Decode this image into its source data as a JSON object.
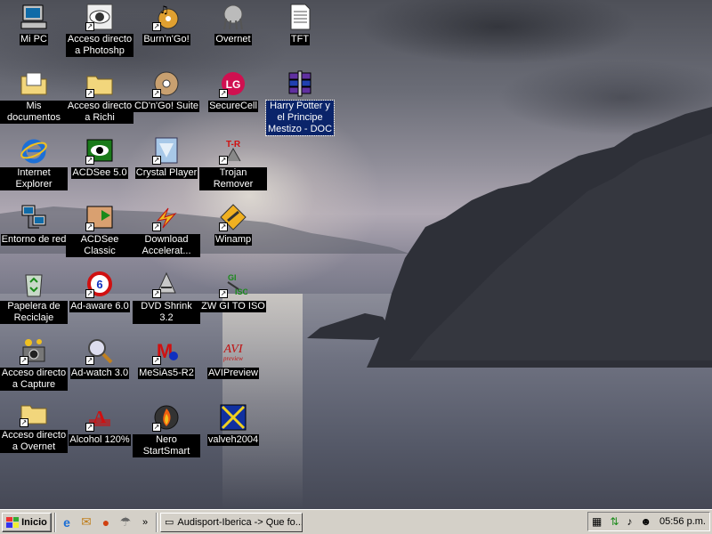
{
  "desktop": {
    "icons": [
      {
        "label": "Mi PC",
        "icon": "my-computer-icon",
        "shortcut": false
      },
      {
        "label": "Acceso directo a Photoshp",
        "icon": "photoshop-eye-icon",
        "shortcut": true
      },
      {
        "label": "Burn'n'Go!",
        "icon": "burn-n-go-icon",
        "shortcut": true
      },
      {
        "label": "Overnet",
        "icon": "overnet-icon",
        "shortcut": false
      },
      {
        "label": "TFT",
        "icon": "text-document-icon",
        "shortcut": false
      },
      {
        "label": "Mis documentos",
        "icon": "my-documents-folder-icon",
        "shortcut": false
      },
      {
        "label": "Acceso directo a Richi",
        "icon": "folder-icon",
        "shortcut": true
      },
      {
        "label": "CD'n'Go! Suite",
        "icon": "cd-disc-icon",
        "shortcut": true
      },
      {
        "label": "SecureCell",
        "icon": "securecell-icon",
        "shortcut": true
      },
      {
        "label": "Harry Potter y el Principe Mestizo - DOC",
        "icon": "winrar-archive-icon",
        "shortcut": false
      },
      {
        "label": "Internet Explorer",
        "icon": "internet-explorer-icon",
        "shortcut": false
      },
      {
        "label": "ACDSee 5.0",
        "icon": "acdsee-eye-icon",
        "shortcut": true
      },
      {
        "label": "Crystal Player",
        "icon": "crystal-player-icon",
        "shortcut": true
      },
      {
        "label": "Trojan Remover",
        "icon": "trojan-remover-icon",
        "shortcut": true
      },
      {
        "label": "Entorno de red",
        "icon": "network-computers-icon",
        "shortcut": false
      },
      {
        "label": "ACDSee Classic",
        "icon": "acdsee-classic-icon",
        "shortcut": true
      },
      {
        "label": "Download Accelerat...",
        "icon": "download-accelerator-icon",
        "shortcut": true
      },
      {
        "label": "Winamp",
        "icon": "winamp-icon",
        "shortcut": true
      },
      {
        "label": "Papelera de Reciclaje",
        "icon": "recycle-bin-icon",
        "shortcut": false
      },
      {
        "label": "Ad-aware 6.0",
        "icon": "ad-aware-icon",
        "shortcut": true
      },
      {
        "label": "DVD Shrink 3.2",
        "icon": "dvd-shrink-icon",
        "shortcut": true
      },
      {
        "label": "ZW GI TO ISO",
        "icon": "gi-to-iso-icon",
        "shortcut": true
      },
      {
        "label": "Acceso directo a Capture",
        "icon": "camera-icon",
        "shortcut": true
      },
      {
        "label": "Ad-watch 3.0",
        "icon": "ad-watch-magnifier-icon",
        "shortcut": true
      },
      {
        "label": "MeSiAs5-R2",
        "icon": "mesias-icon",
        "shortcut": true
      },
      {
        "label": "AVIPreview",
        "icon": "avi-preview-icon",
        "shortcut": false
      },
      {
        "label": "Acceso directo a Overnet",
        "icon": "folder-icon",
        "shortcut": true
      },
      {
        "label": "Alcohol 120%",
        "icon": "alcohol-120-icon",
        "shortcut": true
      },
      {
        "label": "Nero StartSmart",
        "icon": "nero-flame-icon",
        "shortcut": true
      },
      {
        "label": "valveh2004",
        "icon": "valveh-icon",
        "shortcut": false
      }
    ]
  },
  "taskbar": {
    "start_label": "Inicio",
    "quick_launch": [
      "internet-explorer-icon",
      "outlook-express-icon",
      "media-player-icon",
      "overnet-icon"
    ],
    "more_label": "»",
    "task_label": "Audisport-Iberica -> Que fo...",
    "clock": "05:56 p.m.",
    "tray_icons": [
      "network-icon",
      "update-arrows-icon",
      "volume-icon",
      "antivirus-icon"
    ]
  }
}
